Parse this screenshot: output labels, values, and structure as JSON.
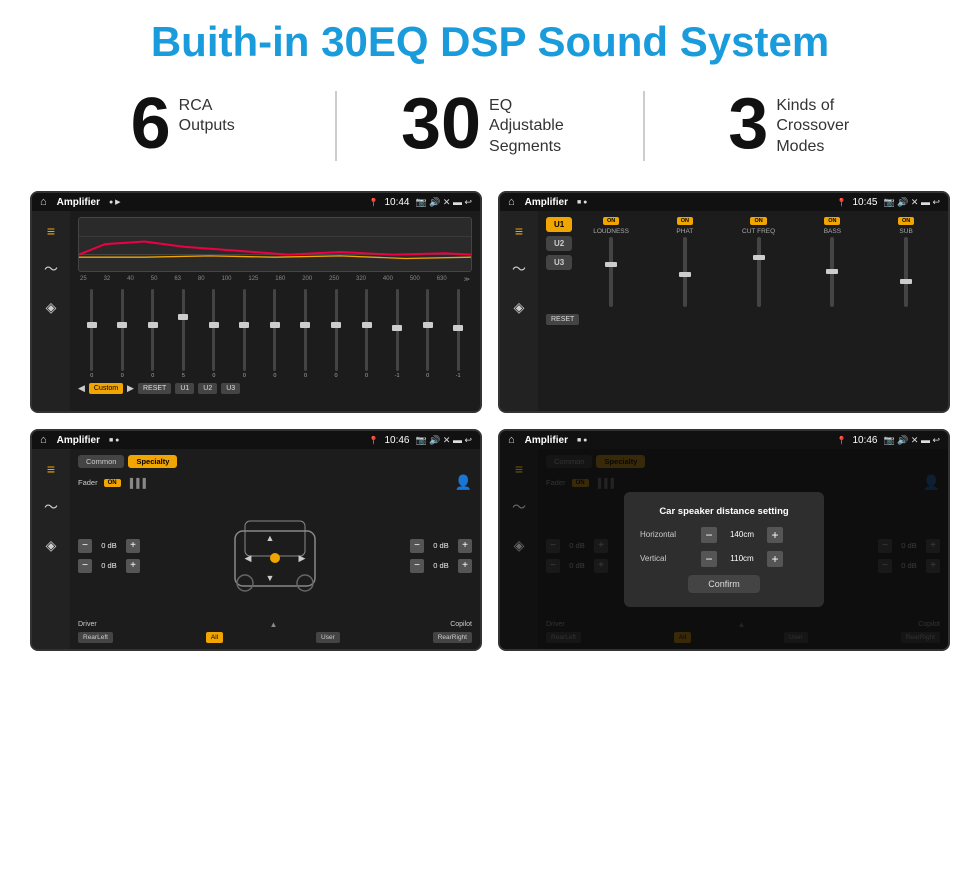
{
  "header": {
    "title": "Buith-in 30EQ DSP Sound System"
  },
  "stats": [
    {
      "number": "6",
      "label_line1": "RCA",
      "label_line2": "Outputs"
    },
    {
      "number": "30",
      "label_line1": "EQ Adjustable",
      "label_line2": "Segments"
    },
    {
      "number": "3",
      "label_line1": "Kinds of",
      "label_line2": "Crossover Modes"
    }
  ],
  "screens": {
    "eq": {
      "status_bar": {
        "app": "Amplifier",
        "time": "10:44"
      },
      "freq_labels": [
        "25",
        "32",
        "40",
        "50",
        "63",
        "80",
        "100",
        "125",
        "160",
        "200",
        "250",
        "320",
        "400",
        "500",
        "630"
      ],
      "slider_values": [
        "0",
        "0",
        "0",
        "5",
        "0",
        "0",
        "0",
        "0",
        "0",
        "0",
        "-1",
        "0",
        "-1"
      ],
      "bottom_buttons": [
        "Custom",
        "RESET",
        "U1",
        "U2",
        "U3"
      ]
    },
    "crossover": {
      "status_bar": {
        "app": "Amplifier",
        "time": "10:45"
      },
      "u_buttons": [
        "U1",
        "U2",
        "U3"
      ],
      "channels": [
        {
          "name": "LOUDNESS",
          "on": true
        },
        {
          "name": "PHAT",
          "on": true
        },
        {
          "name": "CUT FREQ",
          "on": true
        },
        {
          "name": "BASS",
          "on": true
        },
        {
          "name": "SUB",
          "on": true
        }
      ],
      "reset_label": "RESET"
    },
    "fader": {
      "status_bar": {
        "app": "Amplifier",
        "time": "10:46"
      },
      "tabs": [
        "Common",
        "Specialty"
      ],
      "fader_label": "Fader",
      "on_label": "ON",
      "vol_rows": [
        {
          "label": "0 dB",
          "side": "left"
        },
        {
          "label": "0 dB",
          "side": "left"
        },
        {
          "label": "0 dB",
          "side": "right"
        },
        {
          "label": "0 dB",
          "side": "right"
        }
      ],
      "bottom_labels": [
        "Driver",
        "",
        "Copilot",
        "RearLeft",
        "All",
        "User",
        "RearRight"
      ]
    },
    "distance": {
      "status_bar": {
        "app": "Amplifier",
        "time": "10:46"
      },
      "tabs": [
        "Common",
        "Specialty"
      ],
      "dialog": {
        "title": "Car speaker distance setting",
        "horizontal_label": "Horizontal",
        "horizontal_value": "140cm",
        "vertical_label": "Vertical",
        "vertical_value": "110cm",
        "confirm_label": "Confirm"
      },
      "bottom_labels": [
        "Driver",
        "",
        "Copilot",
        "RearLeft",
        "All",
        "User",
        "RearRight"
      ]
    }
  }
}
